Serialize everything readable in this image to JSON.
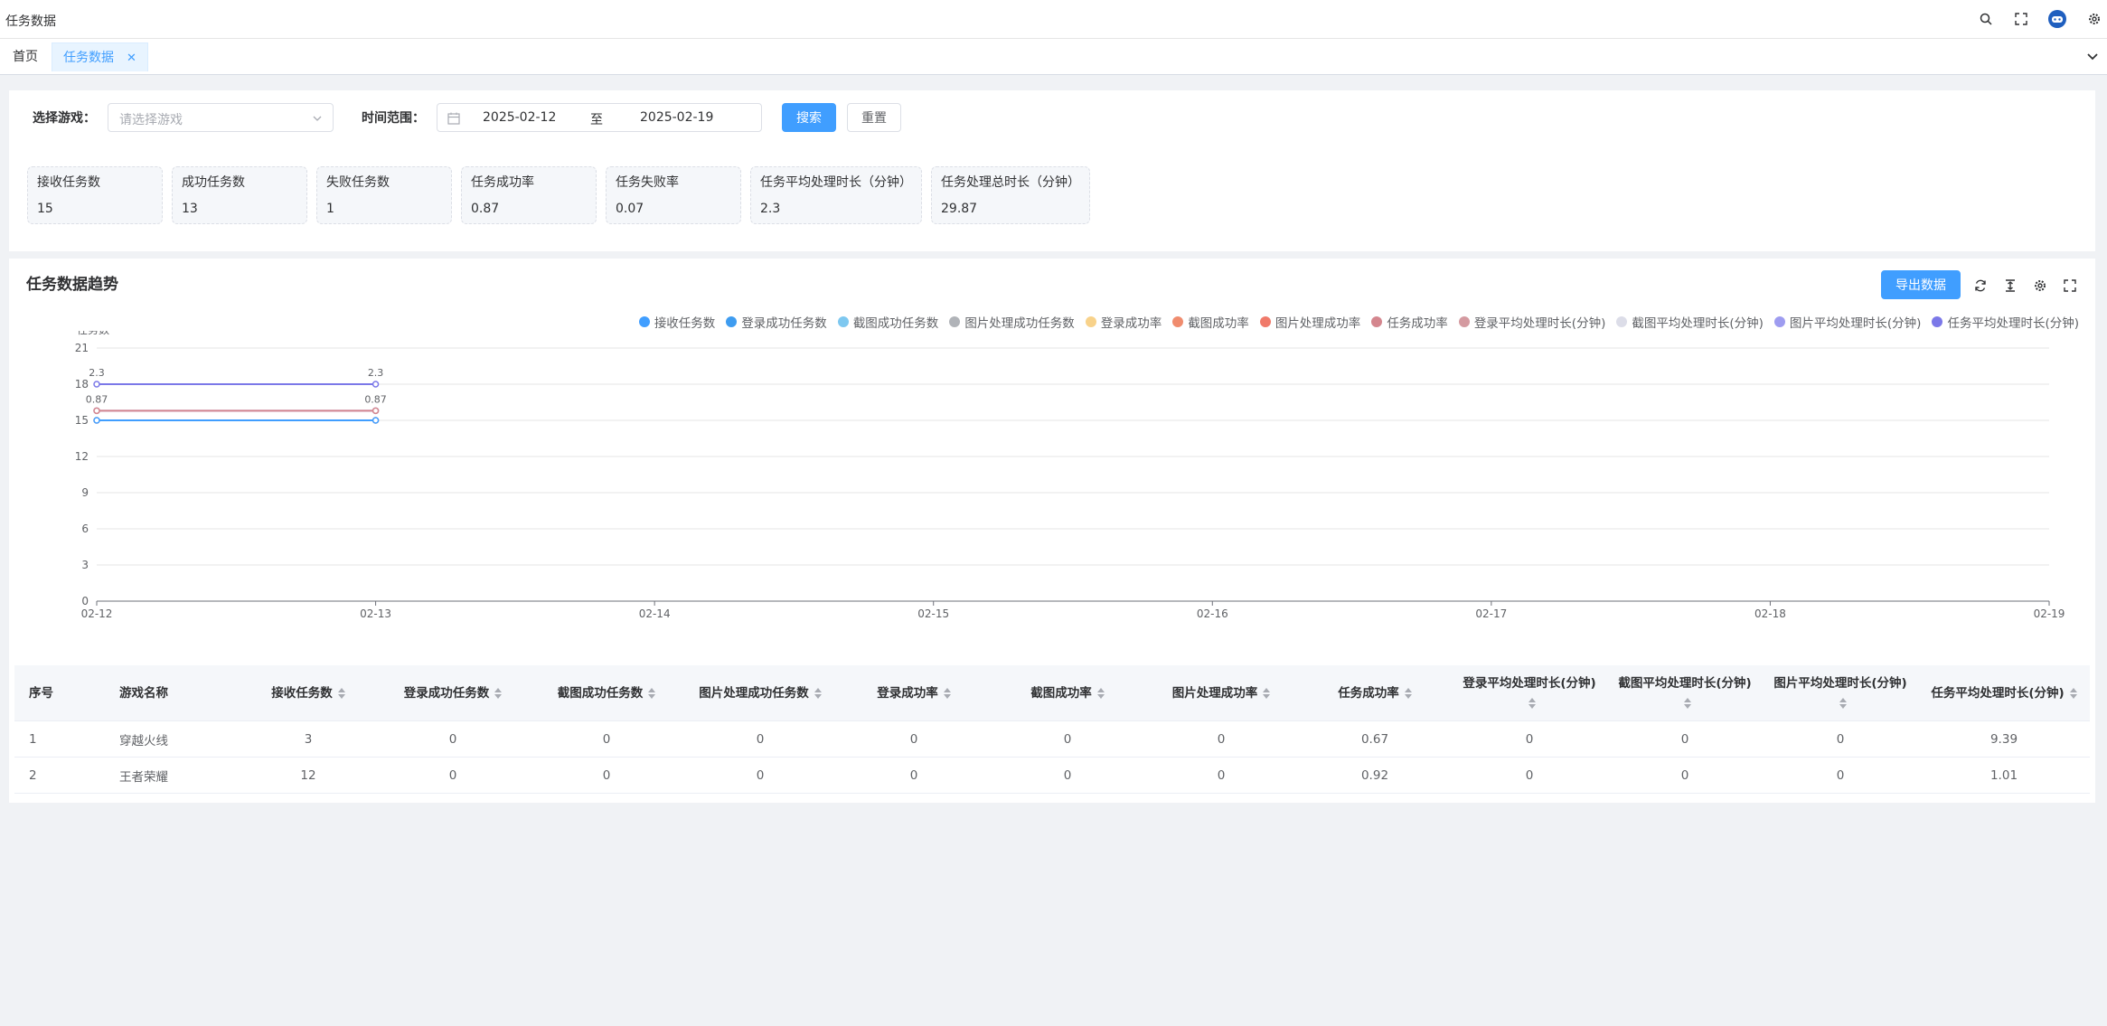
{
  "window": {
    "title": "任务数据"
  },
  "tabs": [
    {
      "label": "首页"
    },
    {
      "label": "任务数据",
      "active": true
    }
  ],
  "filters": {
    "game_label": "选择游戏：",
    "game_placeholder": "请选择游戏",
    "time_label": "时间范围：",
    "date_start": "2025-02-12",
    "date_sep": "至",
    "date_end": "2025-02-19",
    "search_label": "搜索",
    "reset_label": "重置"
  },
  "stats": [
    {
      "label": "接收任务数",
      "value": "15"
    },
    {
      "label": "成功任务数",
      "value": "13"
    },
    {
      "label": "失败任务数",
      "value": "1"
    },
    {
      "label": "任务成功率",
      "value": "0.87"
    },
    {
      "label": "任务失败率",
      "value": "0.07"
    },
    {
      "label": "任务平均处理时长（分钟）",
      "value": "2.3"
    },
    {
      "label": "任务处理总时长（分钟）",
      "value": "29.87"
    }
  ],
  "trend": {
    "title": "任务数据趋势",
    "export_label": "导出数据"
  },
  "chart_data": {
    "type": "line",
    "ylabel": "任务数",
    "ylim": [
      0,
      21
    ],
    "yticks": [
      0,
      3,
      6,
      9,
      12,
      15,
      18,
      21
    ],
    "x": [
      "02-12",
      "02-13",
      "02-14",
      "02-15",
      "02-16",
      "02-17",
      "02-18",
      "02-19"
    ],
    "legend_position": "top-right",
    "series": [
      {
        "name": "接收任务数",
        "color": "#409eff",
        "values": [
          15,
          15
        ]
      },
      {
        "name": "登录成功任务数",
        "color": "#3e9cf0",
        "values": [
          0,
          0
        ]
      },
      {
        "name": "截图成功任务数",
        "color": "#7ec8f0",
        "values": [
          0,
          0
        ]
      },
      {
        "name": "图片处理成功任务数",
        "color": "#b0b3b8",
        "values": [
          0,
          0
        ]
      },
      {
        "name": "登录成功率",
        "color": "#f8d28a",
        "values": [
          0,
          0
        ]
      },
      {
        "name": "截图成功率",
        "color": "#f08c6e",
        "values": [
          0,
          0
        ]
      },
      {
        "name": "图片处理成功率",
        "color": "#f07a6a",
        "values": [
          0,
          0
        ]
      },
      {
        "name": "任务成功率",
        "color": "#d4868e",
        "values": [
          0.87,
          0.87
        ]
      },
      {
        "name": "登录平均处理时长(分钟)",
        "color": "#d49aa0",
        "values": [
          0,
          0
        ]
      },
      {
        "name": "截图平均处理时长(分钟)",
        "color": "#dcdde8",
        "values": [
          0,
          0
        ]
      },
      {
        "name": "图片平均处理时长(分钟)",
        "color": "#9e9cf0",
        "values": [
          0,
          0
        ]
      },
      {
        "name": "任务平均处理时长(分钟)",
        "color": "#7b78e8",
        "values": [
          2.3,
          2.3
        ]
      }
    ],
    "data_labels": [
      {
        "x": "02-12",
        "text": "2.3"
      },
      {
        "x": "02-13",
        "text": "2.3"
      },
      {
        "x": "02-12",
        "text": "0.87"
      },
      {
        "x": "02-13",
        "text": "0.87"
      }
    ]
  },
  "table": {
    "headers": [
      "序号",
      "游戏名称",
      "接收任务数",
      "登录成功任务数",
      "截图成功任务数",
      "图片处理成功任务数",
      "登录成功率",
      "截图成功率",
      "图片处理成功率",
      "任务成功率",
      "登录平均处理时长(分钟)",
      "截图平均处理时长(分钟)",
      "图片平均处理时长(分钟)",
      "任务平均处理时长(分钟)"
    ],
    "rows": [
      [
        "1",
        "穿越火线",
        "3",
        "0",
        "0",
        "0",
        "0",
        "0",
        "0",
        "0.67",
        "0",
        "0",
        "0",
        "9.39"
      ],
      [
        "2",
        "王者荣耀",
        "12",
        "0",
        "0",
        "0",
        "0",
        "0",
        "0",
        "0.92",
        "0",
        "0",
        "0",
        "1.01"
      ]
    ]
  }
}
